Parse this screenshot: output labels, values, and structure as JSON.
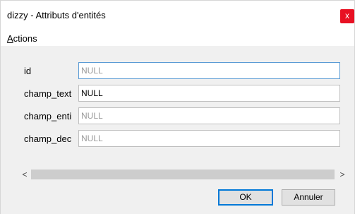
{
  "window": {
    "title": "dizzy - Attributs d'entités",
    "close_glyph": "x"
  },
  "menu": {
    "actions_accel": "A",
    "actions_rest": "ctions"
  },
  "fields": [
    {
      "label": "id",
      "value": "NULL"
    },
    {
      "label": "champ_text",
      "value": "NULL"
    },
    {
      "label": "champ_enti",
      "value": "NULL"
    },
    {
      "label": "champ_dec",
      "value": "NULL"
    }
  ],
  "scrollbar": {
    "left_arrow": "<",
    "right_arrow": ">"
  },
  "buttons": {
    "ok": "OK",
    "cancel": "Annuler"
  },
  "colors": {
    "close_button": "#e81123",
    "focus_border": "#0078d7"
  }
}
